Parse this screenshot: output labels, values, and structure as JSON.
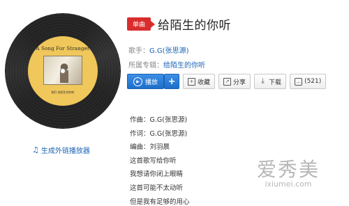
{
  "record": {
    "label_title": "A Song For Stranger",
    "label_small": "我们 给陌生的你听"
  },
  "external_player": {
    "label": "生成外链播放器"
  },
  "badge": "单曲",
  "song_title": "给陌生的你听",
  "singer": {
    "label": "歌手：",
    "value": "G.G(张思源)"
  },
  "album": {
    "label": "所属专辑：",
    "value": "给陌生的你听"
  },
  "actions": {
    "play": "播放",
    "add": "+",
    "collect": "收藏",
    "share": "分享",
    "download": "下载",
    "comment_count": "(521)"
  },
  "lyrics": [
    "作曲：G.G(张思源)",
    "作词：G.G(张思源)",
    "编曲：刘羽晨",
    "这首歌写给你听",
    "我想请你闭上眼睛",
    "这首可能不太动听",
    "但是我有足够的用心"
  ],
  "watermark": {
    "cn": "爱秀美",
    "en": "ixiumei.com"
  }
}
